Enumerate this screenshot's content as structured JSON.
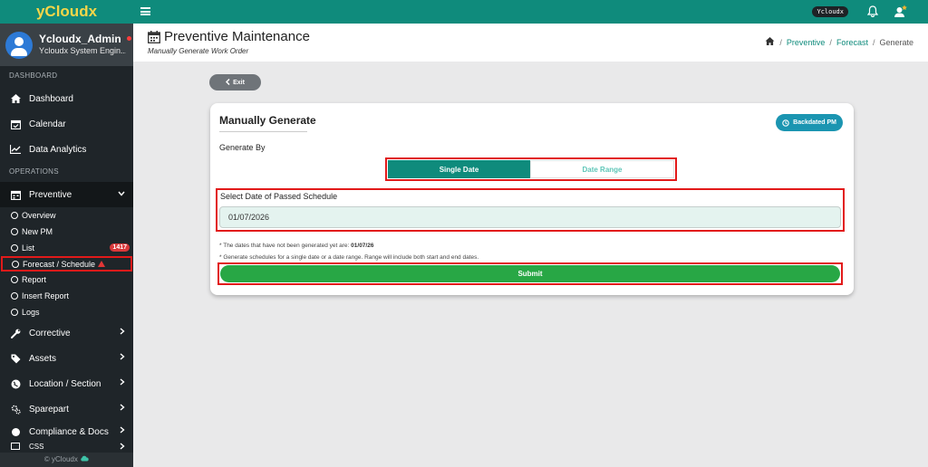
{
  "sidebar": {
    "brand": "yCloudx",
    "user": {
      "name": "Ycloudx_Admin",
      "role": "Ycloudx System Engin..."
    },
    "sections": {
      "dashboard": "DASHBOARD",
      "operations": "OPERATIONS"
    },
    "items": {
      "dashboard": "Dashboard",
      "calendar": "Calendar",
      "analytics": "Data Analytics",
      "preventive": "Preventive",
      "corrective": "Corrective",
      "assets": "Assets",
      "location": "Location / Section",
      "sparepart": "Sparepart",
      "compliance": "Compliance & Docs",
      "css": "CSS"
    },
    "sub_items": {
      "overview": "Overview",
      "new_pm": "New PM",
      "list": "List",
      "list_count": "1417",
      "forecast": "Forecast / Schedule",
      "report": "Report",
      "insert_report": "Insert Report",
      "logs": "Logs"
    },
    "footer": "© yCloudx"
  },
  "topbar": {
    "pill": "Ycloudx"
  },
  "header": {
    "title": "Preventive Maintenance",
    "subtitle": "Manually Generate Work Order",
    "breadcrumb": {
      "preventive": "Preventive",
      "forecast": "Forecast",
      "current": "Generate"
    }
  },
  "content": {
    "exit_label": "Exit",
    "card_title": "Manually Generate",
    "backdated_label": "Backdated PM",
    "generate_by": "Generate By",
    "toggle": {
      "single": "Single Date",
      "range": "Date Range"
    },
    "date_label": "Select Date of Passed Schedule",
    "date_value": "01/07/2026",
    "note1_prefix": "* The dates that have not been generated yet are: ",
    "note1_value": "01/07/26",
    "note2": "* Generate schedules for a single date or a date range. Range will include both start and end dates.",
    "submit_label": "Submit"
  },
  "colors": {
    "teal": "#0f8b7c",
    "sidebar": "#1f2529",
    "green": "#28a745",
    "highlight": "#e21a1a"
  }
}
